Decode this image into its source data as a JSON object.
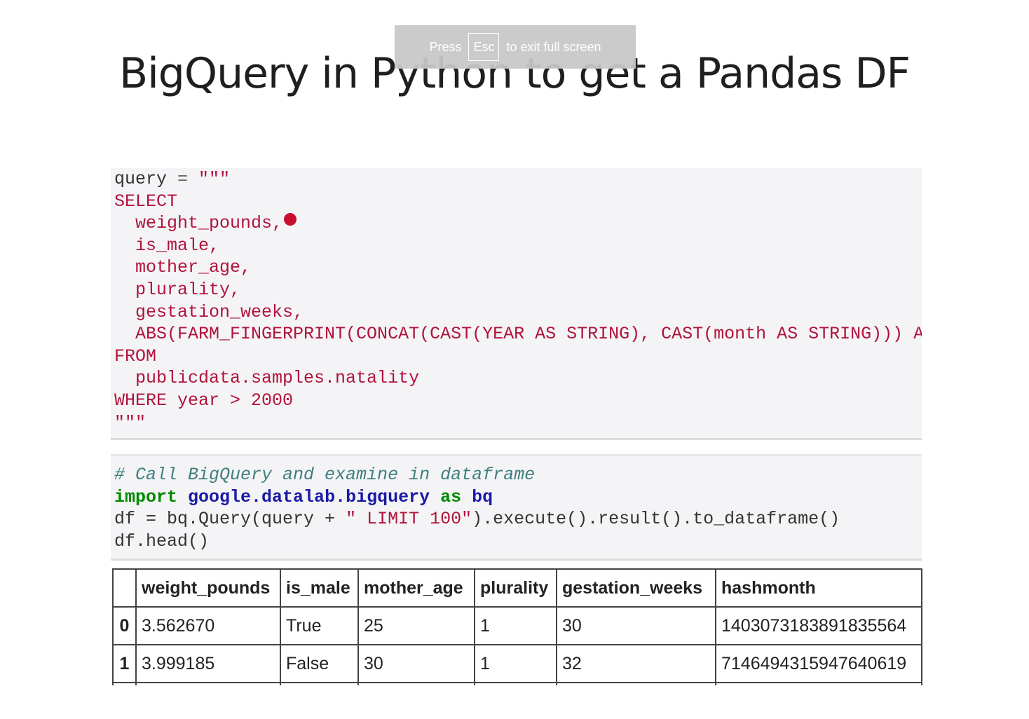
{
  "slide": {
    "title": "BigQuery in Python to get a Pandas DF"
  },
  "fullscreen_toast": {
    "press": "Press",
    "key": "Esc",
    "message": "to exit full screen"
  },
  "cell1": {
    "line1_var": "query",
    "line1_op": " = ",
    "line1_str": "\"\"\"",
    "select": "SELECT",
    "cols": [
      "  weight_pounds,",
      "  is_male,",
      "  mother_age,",
      "  plurality,",
      "  gestation_weeks,",
      "  ABS(FARM_FINGERPRINT(CONCAT(CAST(YEAR AS STRING), CAST(month AS STRING))) AS hashmonth"
    ],
    "from": "FROM",
    "table": "  publicdata.samples.natality",
    "where": "WHERE year > 2000",
    "close": "\"\"\""
  },
  "cell2": {
    "comment": "# Call BigQuery and examine in dataframe",
    "import_kw": "import",
    "module": "google.datalab.bigquery",
    "as_kw": "as",
    "alias": "bq",
    "line3_a": "df = bq.Query(query + ",
    "line3_str": "\" LIMIT 100\"",
    "line3_b": ").execute().result().to_dataframe()",
    "line4": "df.head()"
  },
  "dataframe": {
    "columns": [
      "",
      "weight_pounds",
      "is_male",
      "mother_age",
      "plurality",
      "gestation_weeks",
      "hashmonth"
    ],
    "rows": [
      [
        "0",
        "3.562670",
        "True",
        "25",
        "1",
        "30",
        "1403073183891835564"
      ],
      [
        "1",
        "3.999185",
        "False",
        "30",
        "1",
        "32",
        "7146494315947640619"
      ]
    ]
  }
}
